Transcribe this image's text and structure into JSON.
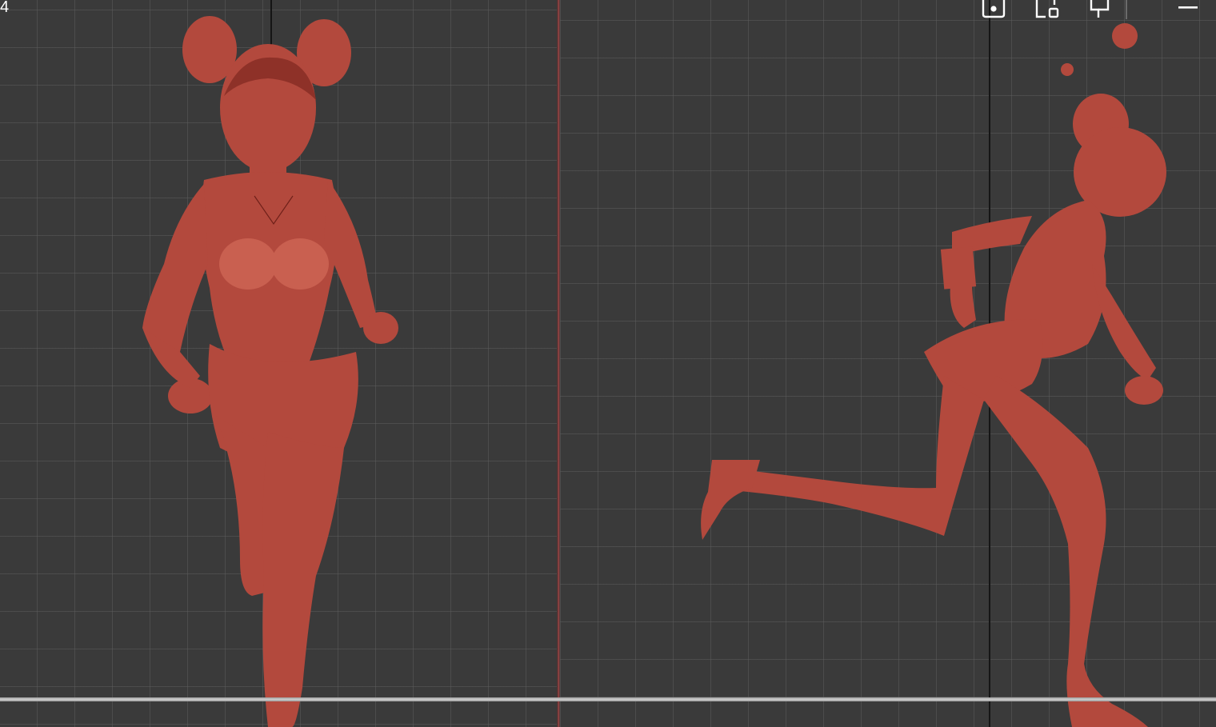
{
  "viewport": {
    "frame_counter": "4",
    "left_view": "front-view",
    "right_view": "side-view"
  },
  "toolbar": {
    "buttons": [
      {
        "name": "screenshot-camera-icon"
      },
      {
        "name": "frame-select-icon"
      },
      {
        "name": "pin-camera-icon"
      },
      {
        "name": "minimize-icon"
      }
    ]
  },
  "colors": {
    "background": "#393939",
    "grid": "#5c5c5c",
    "model": "#b3493d",
    "divider": "#a04848"
  }
}
